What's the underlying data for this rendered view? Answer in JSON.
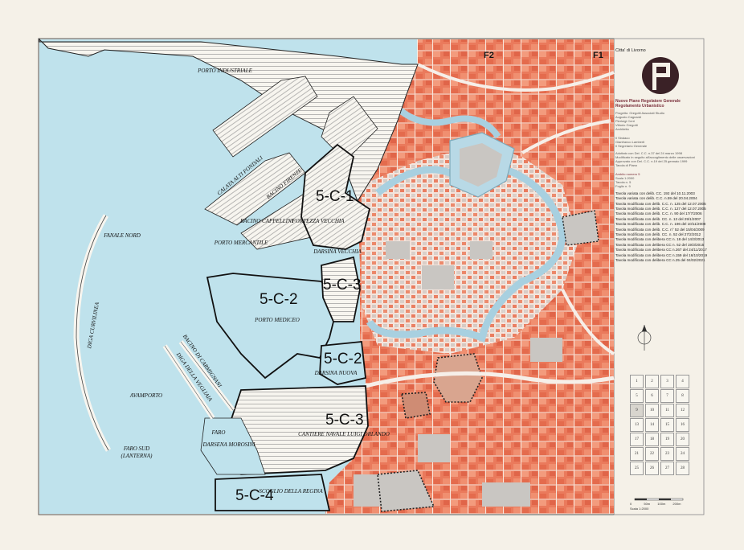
{
  "map": {
    "zones": [
      {
        "id": "5c1",
        "label": "5-C-1"
      },
      {
        "id": "5c3a",
        "label": "5-C-3"
      },
      {
        "id": "5c2a",
        "label": "5-C-2"
      },
      {
        "id": "5c2b",
        "label": "5-C-2"
      },
      {
        "id": "5c3b",
        "label": "5-C-3"
      },
      {
        "id": "5c4",
        "label": "5-C-4"
      }
    ],
    "places": {
      "porto_industriale": "PORTO INDUSTRIALE",
      "porto_mercantile": "PORTO MERCANTILE",
      "bacino_cappellini": "BACINO CAPPELLINI",
      "fortezza_vecchia": "FORTEZZA VECCHIA",
      "darsina_vecchia": "DARSINA VECCHIA",
      "porto_mediceo": "PORTO MEDICEO",
      "darsina_nuova": "DARSINA NUOVA",
      "avamporto": "AVAMPORTO",
      "fanale_nord": "FANALE NORD",
      "faro_sud": "FARO SUD",
      "lanterna": "(LANTERNA)",
      "diga_curvilinea": "DIGA CURVILINEA",
      "diga_vegliaia": "DIGA DELLA VEGLIAIA",
      "darsena_morosini": "DARSENA MOROSINI",
      "faro": "FARO",
      "cantiere": "CANTIERE NAVALE LUIGI ORLANDO",
      "scoglio": "SCOGLIO DELLA REGINA",
      "calata_alti_fondali": "CALATA ALTI FONDALI",
      "bacino_firenze": "BACINO FIRENZE",
      "bacino_carmignani": "BACINO DI CARMIGNANI"
    },
    "sheet_refs": {
      "f2": "F2",
      "f1": "F1"
    },
    "colors": {
      "sea": "#bfe2ec",
      "canal": "#a8d0e0",
      "urban": "#e9765a",
      "block": "#f19b7e",
      "grey": "#c9c6c2",
      "road": "#f6efe9"
    }
  },
  "title_block": {
    "city": "Citta' di Livorno",
    "plan_title": "Nuovo Piano Regolatore Generale",
    "plan_subtitle": "Regolamento Urbanistico",
    "credits": [
      "Progetto: Gregotti Associati Studio",
      "Augusto Cagnardi",
      "Pierluigi Cerri",
      "Vittorio Gregotti",
      "Architetto"
    ],
    "staff": [
      "Il Sindaco",
      "Gianfranco Lamberti",
      "Il Segretario Generale"
    ],
    "adoption": [
      "Adottato con Del. C.C. n.37 del 24 marzo 1998",
      "Modificato in seguito all'accoglimento delle osservazioni",
      "Approvato con Del. C.C. n.19 del 25 gennaio 1999",
      "Tavola di Piano"
    ],
    "sheet_block": [
      "Ambito numero 5",
      "Scala 1:2000",
      "Tavola n. 5",
      "Foglio n. 9"
    ],
    "revisions": [
      "Tavola variata con delib. CC. 192 del 10.11.2003",
      "Tavola variata con delib. C.C. n.59 del 20.04.2004",
      "Tavola modificata con delib. C.C. n. 125 del 12.07.2005",
      "Tavola modificata con delib. C.C. n. 127 del 12.07.2005",
      "Tavola modificata con delib. C.C. n. 90 del 17/7/2006",
      "Tavola modificata con delib. CC. n. 13 del 29/1/2007",
      "Tavola modificata con delib. C.C. n. 196 del 10/11/2008",
      "Tavola modificata con delib. C.C. n° 52 del 15/04/2009",
      "Tavola modificata con delib. CC. n. 52 del 27/2/2012",
      "Tavola modificata con delibera CC n. 18 del 14/3/2013",
      "Tavola modificata con delibera CC n. 52 del 19/3/2015",
      "Tavola modificata con delibera CC n.267 del 24/11/2017",
      "Tavola modificata con delibera CC n.159 del 16/10/2019",
      "Tavola modificata con delibera CC n.25 del 04/02/2021"
    ],
    "sheet_index": [
      "1",
      "2",
      "3",
      "4",
      "5",
      "6",
      "7",
      "8",
      "9",
      "10",
      "11",
      "12",
      "13",
      "14",
      "15",
      "16",
      "17",
      "18",
      "19",
      "20",
      "21",
      "22",
      "23",
      "24",
      "25",
      "26",
      "27",
      "28"
    ],
    "scale_bar": [
      "0",
      "50m",
      "100m",
      "200m"
    ],
    "scale_label": "Scala 1:2000"
  }
}
